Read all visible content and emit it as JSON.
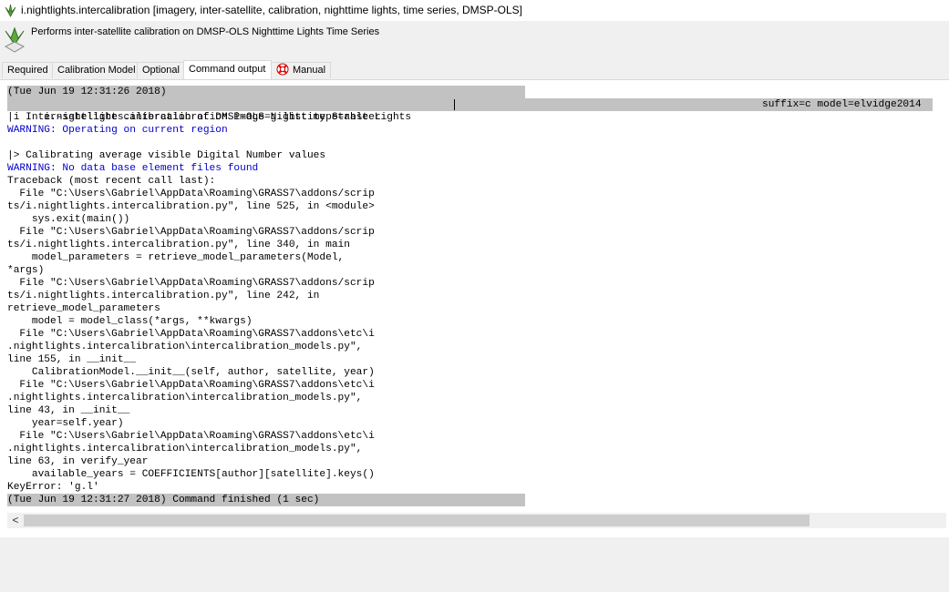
{
  "window": {
    "title": "i.nightlights.intercalibration [imagery, inter-satellite, calibration, nighttime lights, time series, DMSP-OLS]",
    "icon": "grass-icon"
  },
  "header": {
    "description": "Performs inter-satellite calibration on DMSP-OLS Nighttime Lights Time Series",
    "icon": "grass-icon"
  },
  "tabs": [
    {
      "label": "Required"
    },
    {
      "label": "Calibration Model"
    },
    {
      "label": "Optional"
    },
    {
      "label": "Command output"
    },
    {
      "label": "Manual",
      "icon": "lifebuoy-icon"
    }
  ],
  "active_tab": "Command output",
  "colors": {
    "warning": "#0000cc",
    "highlight": "#c2c2c2"
  },
  "console": {
    "start_time": "(Tue Jun 19 12:31:26 2018)",
    "command_left": "i.nightlights.intercalibration image=g.list type=raster",
    "command_right": "suffix=c model=elvidge2014",
    "lines": [
      {
        "text": "|i Inter-satellite calibration of DMSP-OLS Nighttime Stable Lights",
        "kind": "normal"
      },
      {
        "text": "WARNING: Operating on current region",
        "kind": "warn"
      },
      {
        "text": "",
        "kind": "normal"
      },
      {
        "text": "|> Calibrating average visible Digital Number values",
        "kind": "normal"
      },
      {
        "text": "WARNING: No data base element files found",
        "kind": "warn"
      },
      {
        "text": "Traceback (most recent call last):",
        "kind": "normal"
      },
      {
        "text": "  File \"C:\\Users\\Gabriel\\AppData\\Roaming\\GRASS7\\addons/scrip",
        "kind": "normal"
      },
      {
        "text": "ts/i.nightlights.intercalibration.py\", line 525, in <module>",
        "kind": "normal"
      },
      {
        "text": "    sys.exit(main())",
        "kind": "normal"
      },
      {
        "text": "  File \"C:\\Users\\Gabriel\\AppData\\Roaming\\GRASS7\\addons/scrip",
        "kind": "normal"
      },
      {
        "text": "ts/i.nightlights.intercalibration.py\", line 340, in main",
        "kind": "normal"
      },
      {
        "text": "    model_parameters = retrieve_model_parameters(Model,",
        "kind": "normal"
      },
      {
        "text": "*args)",
        "kind": "normal"
      },
      {
        "text": "  File \"C:\\Users\\Gabriel\\AppData\\Roaming\\GRASS7\\addons/scrip",
        "kind": "normal"
      },
      {
        "text": "ts/i.nightlights.intercalibration.py\", line 242, in",
        "kind": "normal"
      },
      {
        "text": "retrieve_model_parameters",
        "kind": "normal"
      },
      {
        "text": "    model = model_class(*args, **kwargs)",
        "kind": "normal"
      },
      {
        "text": "  File \"C:\\Users\\Gabriel\\AppData\\Roaming\\GRASS7\\addons\\etc\\i",
        "kind": "normal"
      },
      {
        "text": ".nightlights.intercalibration\\intercalibration_models.py\",",
        "kind": "normal"
      },
      {
        "text": "line 155, in __init__",
        "kind": "normal"
      },
      {
        "text": "    CalibrationModel.__init__(self, author, satellite, year)",
        "kind": "normal"
      },
      {
        "text": "  File \"C:\\Users\\Gabriel\\AppData\\Roaming\\GRASS7\\addons\\etc\\i",
        "kind": "normal"
      },
      {
        "text": ".nightlights.intercalibration\\intercalibration_models.py\",",
        "kind": "normal"
      },
      {
        "text": "line 43, in __init__",
        "kind": "normal"
      },
      {
        "text": "    year=self.year)",
        "kind": "normal"
      },
      {
        "text": "  File \"C:\\Users\\Gabriel\\AppData\\Roaming\\GRASS7\\addons\\etc\\i",
        "kind": "normal"
      },
      {
        "text": ".nightlights.intercalibration\\intercalibration_models.py\",",
        "kind": "normal"
      },
      {
        "text": "line 63, in verify_year",
        "kind": "normal"
      },
      {
        "text": "    available_years = COEFFICIENTS[author][satellite].keys()",
        "kind": "normal"
      },
      {
        "text": "KeyError: 'g.l'",
        "kind": "normal"
      }
    ],
    "end_status": "(Tue Jun 19 12:31:27 2018) Command finished (1 sec)"
  },
  "scrollbar": {
    "left_arrow": "<"
  }
}
